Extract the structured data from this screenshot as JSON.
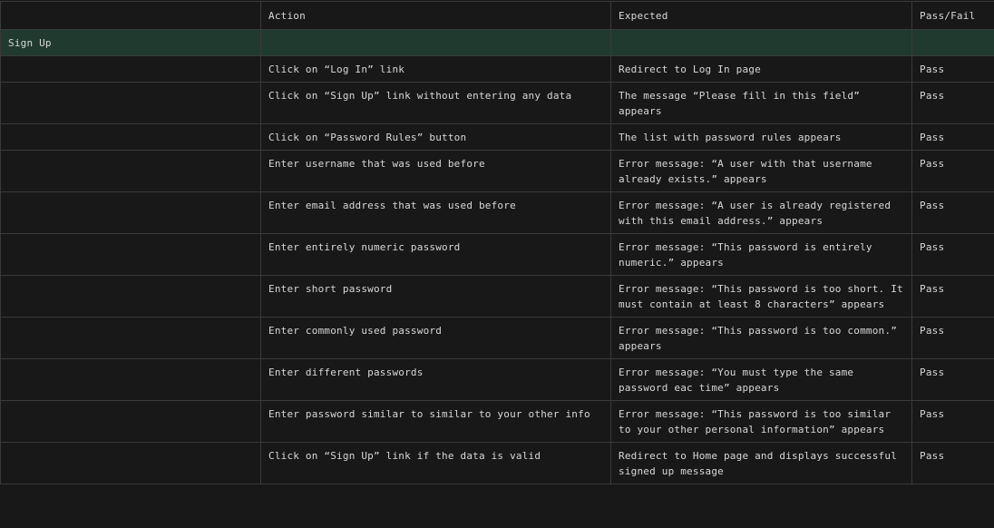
{
  "table": {
    "headers": {
      "col1": "",
      "action": "Action",
      "expected": "Expected",
      "result": "Pass/Fail"
    },
    "section": {
      "title": "Sign Up"
    },
    "rows": [
      {
        "action": "Click on “Log In” link",
        "expected": "Redirect to Log In page",
        "result": "Pass"
      },
      {
        "action": "Click on “Sign Up” link without entering any data",
        "expected": "The message “Please fill in this field” appears",
        "result": "Pass"
      },
      {
        "action": "Click on “Password Rules” button",
        "expected": "The list with password rules appears",
        "result": "Pass"
      },
      {
        "action": "Enter username that was used before",
        "expected": "Error message: “A user with that username already exists.” appears",
        "result": "Pass"
      },
      {
        "action": "Enter email address that was used before",
        "expected": "Error message: “A user is already registered with this email address.” appears",
        "result": "Pass"
      },
      {
        "action": "Enter entirely numeric password",
        "expected": "Error message: “This password is entirely numeric.” appears",
        "result": "Pass"
      },
      {
        "action": "Enter short password",
        "expected": "Error message: “This password is too short. It must contain at least 8 characters” appears",
        "result": "Pass"
      },
      {
        "action": "Enter commonly used password",
        "expected": "Error message: “This password is too common.” appears",
        "result": "Pass"
      },
      {
        "action": "Enter different passwords",
        "expected": "Error message: “You must type the same password eac time” appears",
        "result": "Pass"
      },
      {
        "action": "Enter password similar to similar to your other info",
        "expected": "Error message: “This password is too similar to your other personal information” appears",
        "result": "Pass"
      },
      {
        "action": "Click on “Sign Up” link if the data is valid",
        "expected": "Redirect to Home page and displays successful signed up message",
        "result": "Pass"
      }
    ]
  }
}
